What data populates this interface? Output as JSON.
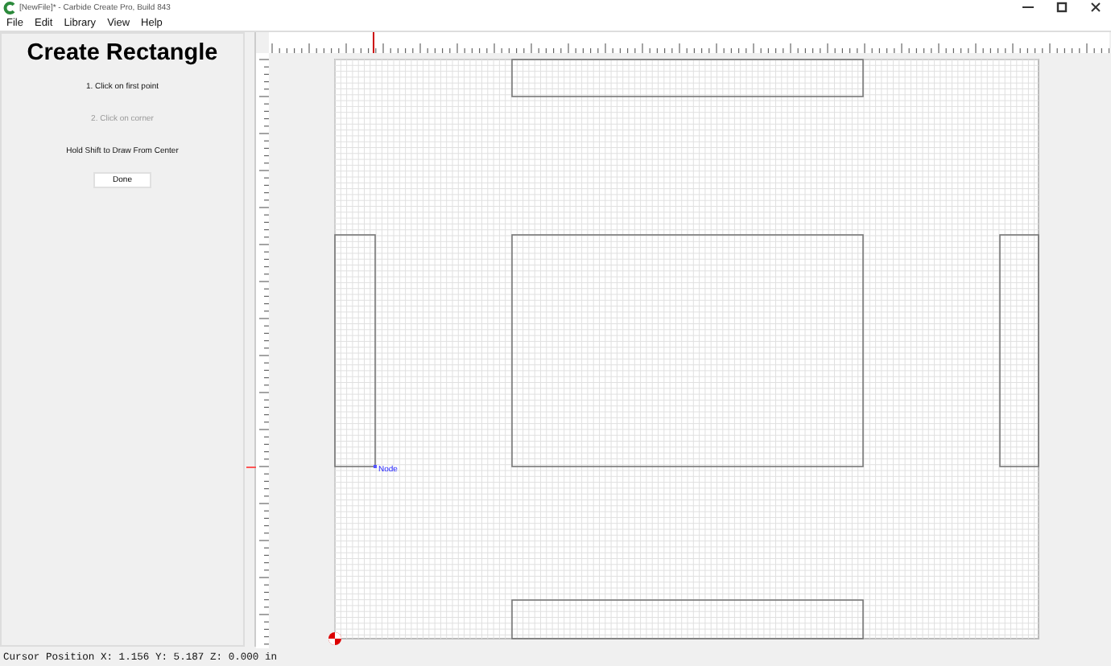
{
  "window": {
    "title": "[NewFile]* - Carbide Create Pro, Build 843"
  },
  "menu": [
    "File",
    "Edit",
    "Library",
    "View",
    "Help"
  ],
  "panel": {
    "title": "Create Rectangle",
    "steps": [
      {
        "text": "1. Click on first point",
        "disabled": false
      },
      {
        "text": "2. Click on corner",
        "disabled": true
      }
    ],
    "hint": "Hold Shift to Draw From Center",
    "button": "Done"
  },
  "canvas": {
    "node_label": "Node"
  },
  "status_bar": "Cursor Position X: 1.156 Y: 5.187 Z: 0.000 in"
}
